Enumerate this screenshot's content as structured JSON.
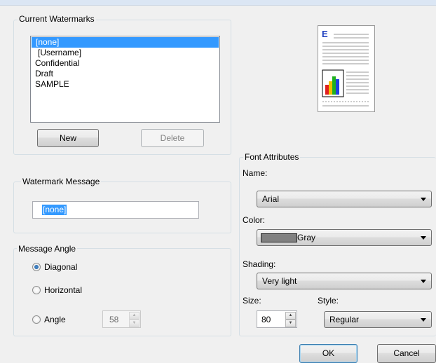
{
  "current_watermarks": {
    "legend": "Current Watermarks",
    "items": [
      "[none]",
      "[Username]",
      "Confidential",
      "Draft",
      "SAMPLE"
    ],
    "selected_index": 0,
    "new_button": "New",
    "delete_button": "Delete"
  },
  "watermark_message": {
    "legend": "Watermark Message",
    "value": "[none]"
  },
  "message_angle": {
    "legend": "Message Angle",
    "options": [
      "Diagonal",
      "Horizontal",
      "Angle"
    ],
    "selected": "Diagonal",
    "angle_value": "58"
  },
  "font_attributes": {
    "legend": "Font Attributes",
    "name_label": "Name:",
    "name_value": "Arial",
    "color_label": "Color:",
    "color_value": "Gray",
    "color_swatch": "#808080",
    "shading_label": "Shading:",
    "shading_value": "Very light",
    "size_label": "Size:",
    "size_value": "80",
    "style_label": "Style:",
    "style_value": "Regular"
  },
  "preview": {
    "letter": "E",
    "letter_color": "#1f3fbf",
    "bar_colors": [
      "#e02020",
      "#f0c000",
      "#20b020",
      "#2040e0"
    ]
  },
  "footer": {
    "ok_button": "OK",
    "cancel_button": "Cancel"
  }
}
